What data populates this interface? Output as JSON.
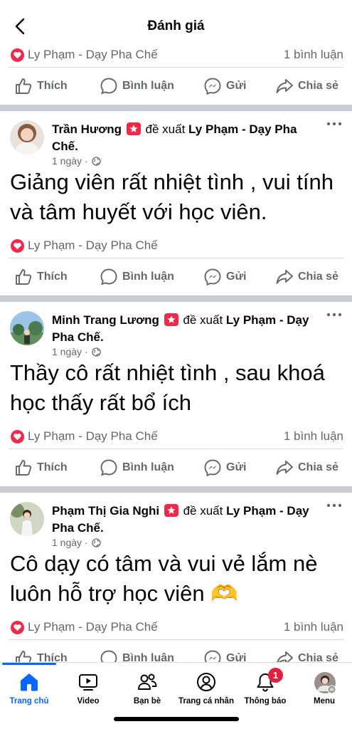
{
  "header": {
    "title": "Đánh giá"
  },
  "top_partial": {
    "page_name": "Ly Phạm - Dạy Pha Chế",
    "comment_count": "1 bình luận"
  },
  "action_labels": {
    "like": "Thích",
    "comment": "Bình luận",
    "send": "Gửi",
    "share": "Chia sẻ"
  },
  "posts": [
    {
      "author": "Trần Hương",
      "verb": "đề xuất",
      "target": "Ly Phạm - Dạy Pha Chế.",
      "time": "1 ngày",
      "text": "Giảng viên rất nhiệt tình , vui tính và tâm huyết với học viên.",
      "page_name": "Ly Phạm - Dạy Pha Chế",
      "comment_count": ""
    },
    {
      "author": "Minh Trang Lương",
      "verb": "đề xuất",
      "target": "Ly Phạm - Dạy Pha Chế.",
      "time": "1 ngày",
      "text": "Thầy cô rất nhiệt tình , sau khoá học thấy rất bổ ích",
      "page_name": "Ly Phạm - Dạy Pha Chế",
      "comment_count": "1 bình luận"
    },
    {
      "author": "Phạm Thị Gia Nghi",
      "verb": "đề xuất",
      "target": "Ly Phạm - Dạy Pha Chế.",
      "time": "1 ngày",
      "text": "Cô dạy có tâm và vui vẻ lắm nè luôn hỗ trợ học viên 🫶",
      "page_name": "Ly Phạm - Dạy Pha Chế",
      "comment_count": "1 bình luận"
    }
  ],
  "tabbar": {
    "home": "Trang chủ",
    "video": "Video",
    "friends": "Bạn bè",
    "profile": "Trang cá nhân",
    "notifications": "Thông báo",
    "notifications_badge": "1",
    "menu": "Menu"
  },
  "colors": {
    "accent": "#0866ff",
    "heart": "#e41e3f",
    "recommend": "#f02849"
  }
}
